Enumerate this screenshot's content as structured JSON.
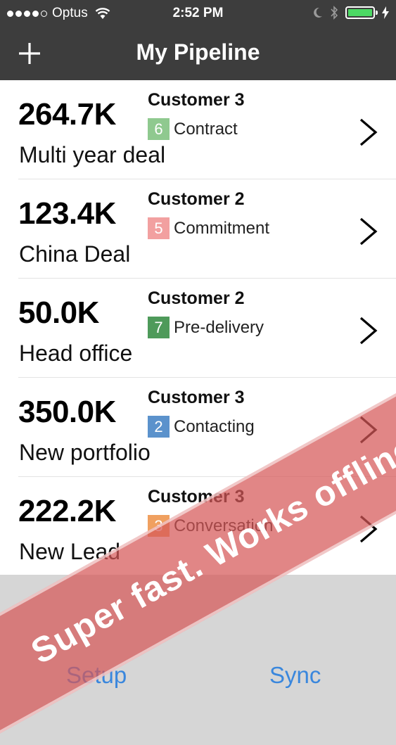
{
  "status_bar": {
    "carrier": "Optus",
    "time": "2:52 PM",
    "signal_icon": "signal-dots-icon",
    "wifi_icon": "wifi-icon",
    "battery_color": "#4cd964"
  },
  "nav": {
    "title": "My Pipeline",
    "add_icon": "plus-icon"
  },
  "deals": [
    {
      "amount": "264.7K",
      "name": "Multi year deal",
      "customer": "Customer 3",
      "stage_num": "6",
      "stage_label": "Contract",
      "stage_color": "#8fc98f"
    },
    {
      "amount": "123.4K",
      "name": "China Deal",
      "customer": "Customer 2",
      "stage_num": "5",
      "stage_label": "Commitment",
      "stage_color": "#f2a0a0"
    },
    {
      "amount": "50.0K",
      "name": "Head office",
      "customer": "Customer 2",
      "stage_num": "7",
      "stage_label": "Pre-delivery",
      "stage_color": "#4e9a5a"
    },
    {
      "amount": "350.0K",
      "name": "New portfolio",
      "customer": "Customer 3",
      "stage_num": "2",
      "stage_label": "Contacting",
      "stage_color": "#5b92cc"
    },
    {
      "amount": "222.2K",
      "name": "New Lead",
      "customer": "Customer 3",
      "stage_num": "3",
      "stage_label": "Conversation",
      "stage_color": "#f0a060"
    }
  ],
  "toolbar": {
    "setup_label": "Setup",
    "sync_label": "Sync"
  },
  "banner": {
    "text": "Super fast. Works offline."
  },
  "colors": {
    "header_bg": "#3d3d3d",
    "toolbar_link": "#3a87dd",
    "banner": "#d65858"
  }
}
